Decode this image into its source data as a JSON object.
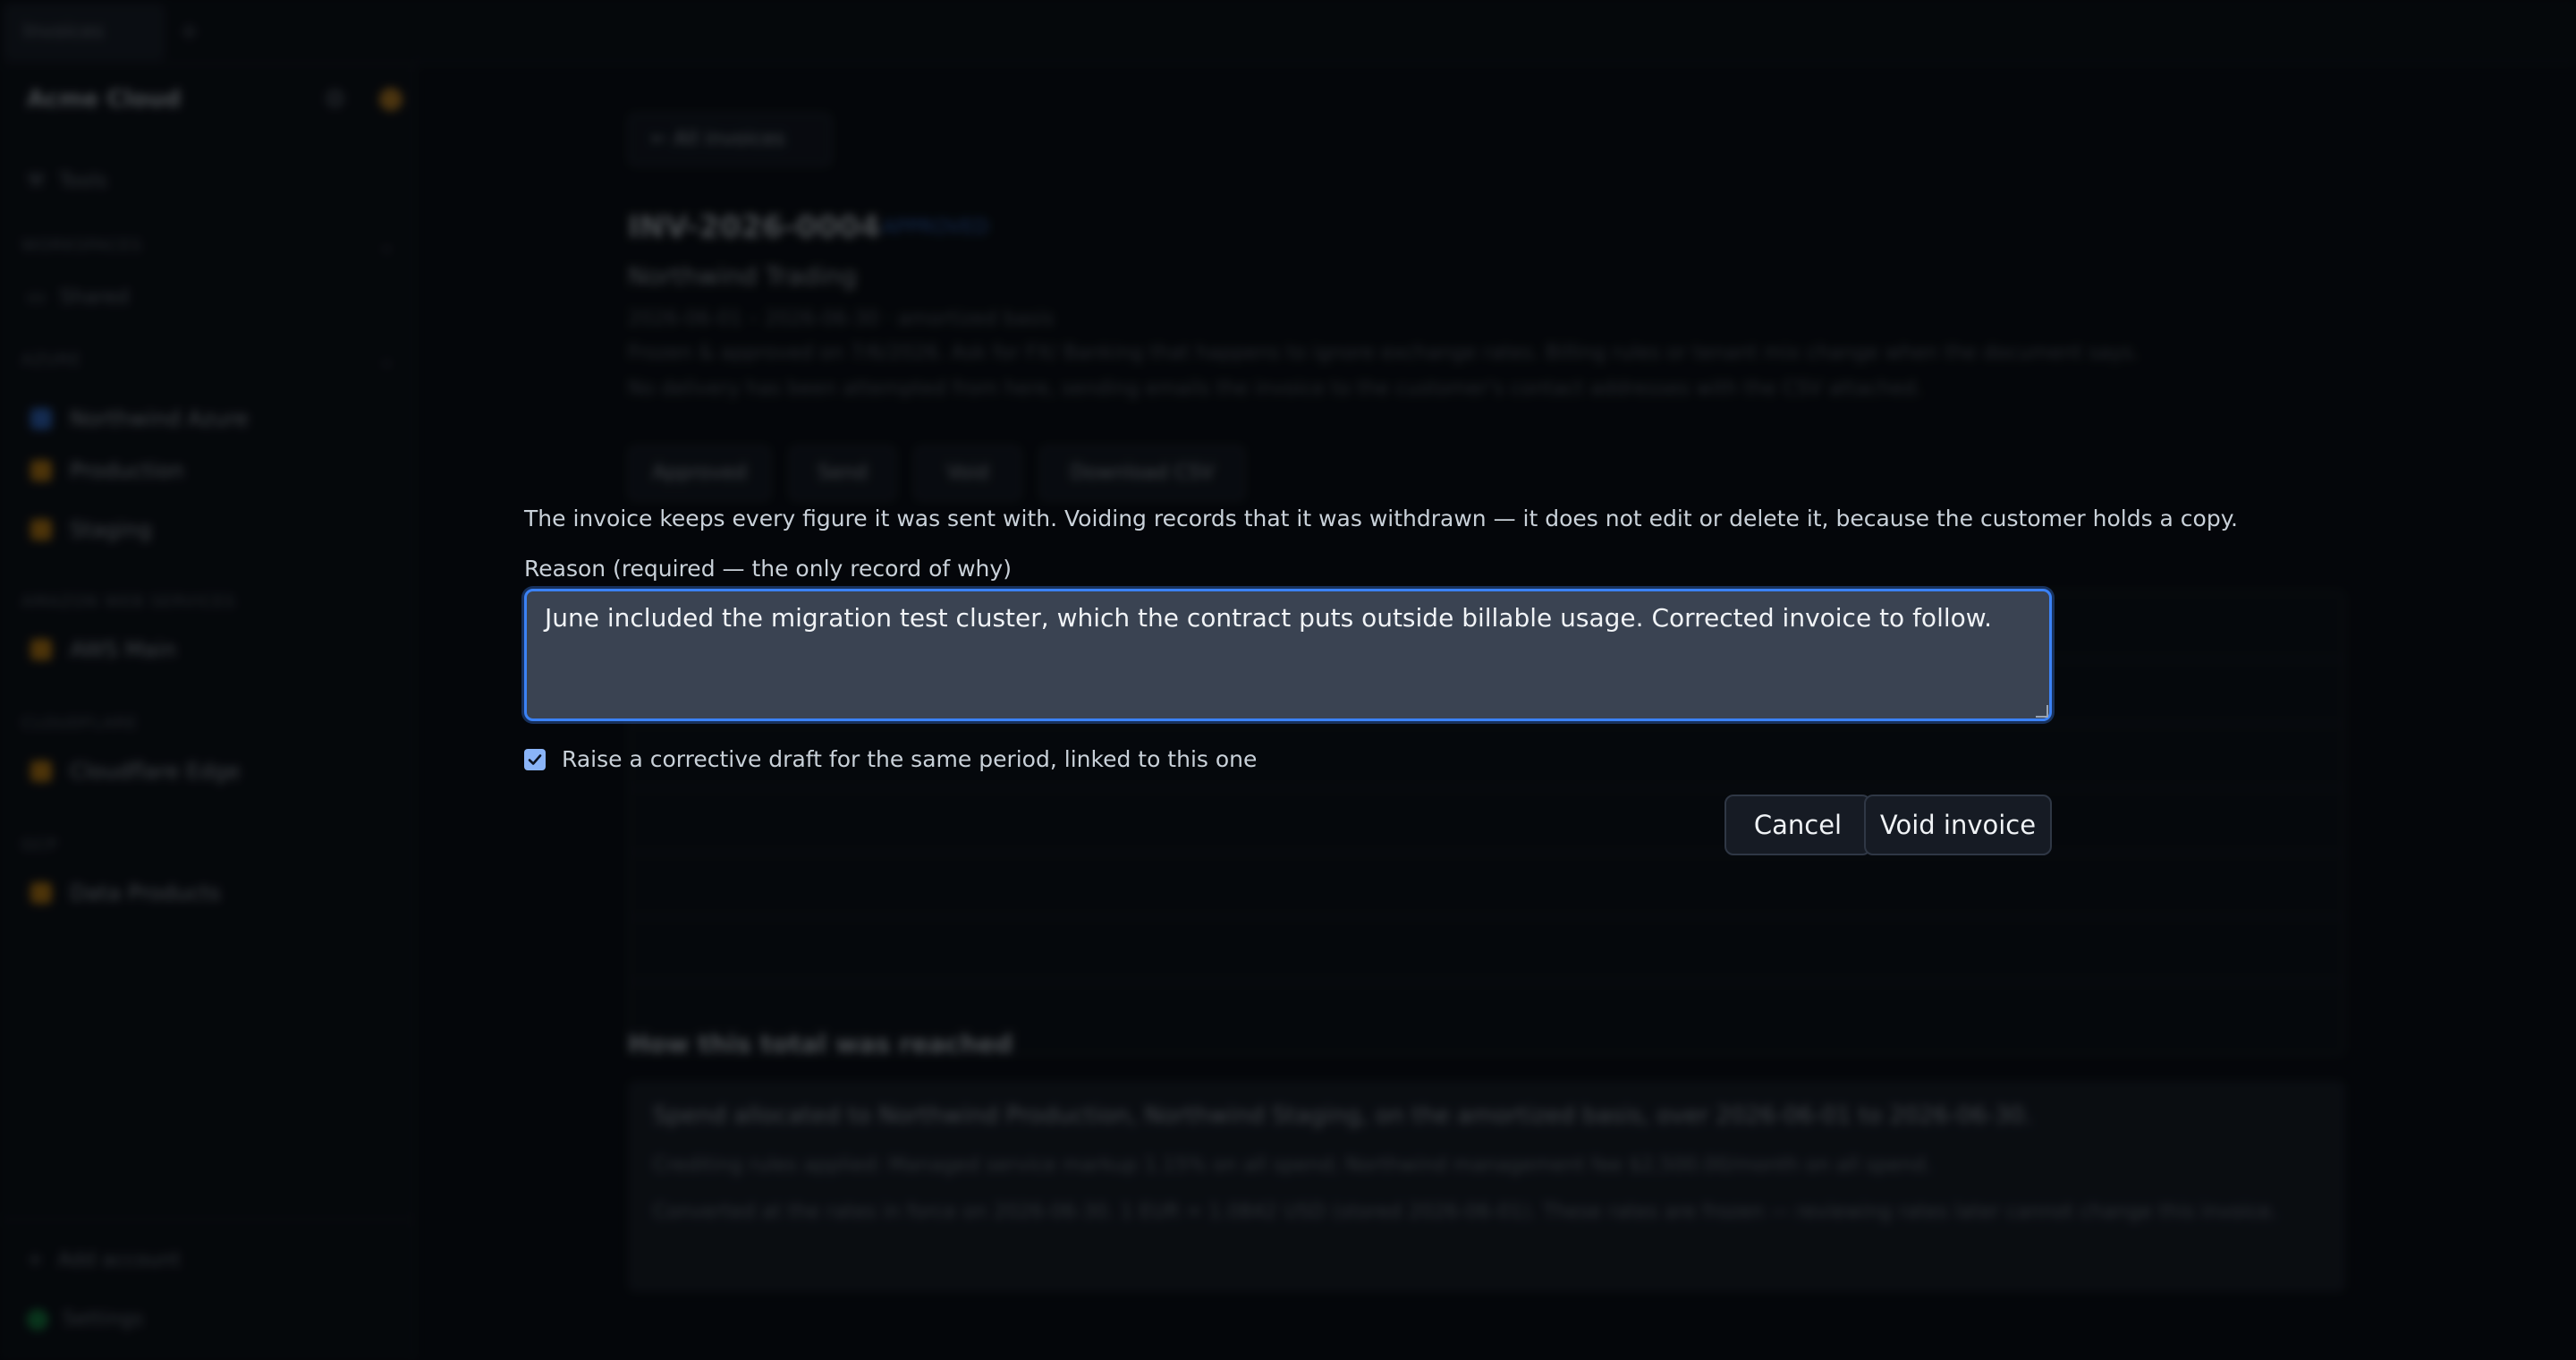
{
  "top_tab": "Invoices",
  "sidebar": {
    "brand": "Acme Cloud",
    "tools": "Tools",
    "section_workspaces": "WORKSPACES",
    "shared": "Shared",
    "section_azure": "AZURE",
    "items_azure": [
      "Northwind Azure",
      "Production",
      "Staging"
    ],
    "section_aws": "AMAZON WEB SERVICES",
    "items_aws": [
      "AWS Main"
    ],
    "section_cloudflare": "CLOUDFLARE",
    "items_cloudflare": [
      "Cloudflare Edge"
    ],
    "section_gcp": "GCP",
    "items_gcp": [
      "Data Products"
    ],
    "add_account": "Add account",
    "settings": "Settings"
  },
  "invoice": {
    "back": "All invoices",
    "number": "INV-2026-0004",
    "status": "APPROVED",
    "customer": "Northwind Trading",
    "period": "2026-06-01 – 2026-06-30 · amortized basis",
    "line1": "Frozen & approved on 7/6/2026. Ask for FX/ Banking that happens to ignore exchange rates. Billing rules or tenant mix change when the document says.",
    "line2": "No delivery has been attempted from here, sending emails the invoice to the customer's contact addresses with the CSV attached.",
    "buttons": [
      "Approved",
      "Send",
      "Void",
      "Download CSV"
    ],
    "section_title": "How this total was reached",
    "explain_1": "Spend allocated to Northwind Production, Northwind Staging, on the amortized basis, over 2026-06-01 to 2026-06-30.",
    "explain_2": "Crediting rules applied: Managed service markup 1.15% on all spend; Northwind management fee $2,500.00/month on all spend.",
    "explain_3": "Converted at the rates in force on 2026-06-30. 1 EUR = 1.0842 USD (stored 2026-06-01). These rates are frozen — reviewing rates later cannot change this invoice."
  },
  "dialog": {
    "description": "The invoice keeps every figure it was sent with. Voiding records that it was withdrawn — it does not edit or delete it, because the customer holds a copy.",
    "reason_label": "Reason (required — the only record of why)",
    "reason_value": "June included the migration test cluster, which the contract puts outside billable usage. Corrected invoice to follow.",
    "checkbox_label": "Raise a corrective draft for the same period, linked to this one",
    "checkbox_checked": true,
    "cancel_label": "Cancel",
    "void_label": "Void invoice",
    "accent_color": "#3b82f6"
  }
}
